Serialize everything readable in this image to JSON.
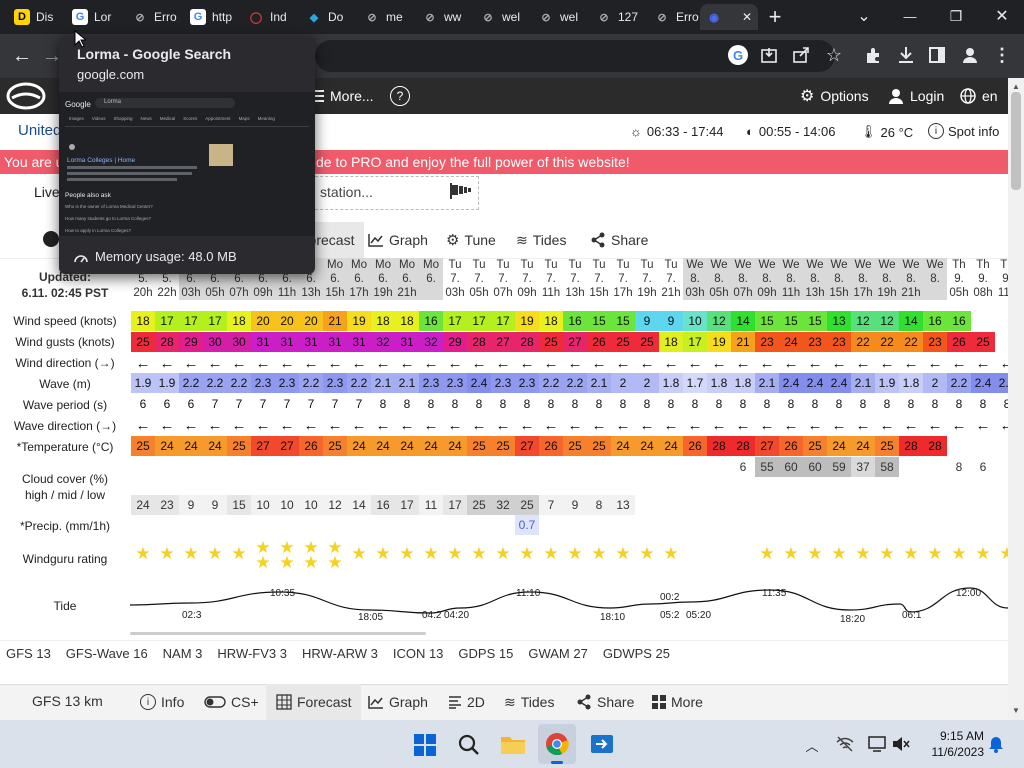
{
  "browser": {
    "tabs": [
      {
        "label": "Dis",
        "fav": "D",
        "favbg": "#ffd400",
        "favfg": "#000"
      },
      {
        "label": "Lor",
        "fav": "G",
        "favbg": "#fff",
        "favfg": "#4285f4"
      },
      {
        "label": "Erro",
        "fav": "⊘",
        "favbg": "#202124",
        "favfg": "#aaa"
      },
      {
        "label": "http",
        "fav": "G",
        "favbg": "#fff",
        "favfg": "#4285f4"
      },
      {
        "label": "Ind",
        "fav": "◯",
        "favbg": "#202124",
        "favfg": "#e53935"
      },
      {
        "label": "Do",
        "fav": "◆",
        "favbg": "#202124",
        "favfg": "#2aa6e0"
      },
      {
        "label": "me",
        "fav": "⊘",
        "favbg": "#202124",
        "favfg": "#aaa"
      },
      {
        "label": "ww",
        "fav": "⊘",
        "favbg": "#202124",
        "favfg": "#aaa"
      },
      {
        "label": "wel",
        "fav": "⊘",
        "favbg": "#202124",
        "favfg": "#aaa"
      },
      {
        "label": "wel",
        "fav": "⊘",
        "favbg": "#202124",
        "favfg": "#aaa"
      },
      {
        "label": "127",
        "fav": "⊘",
        "favbg": "#202124",
        "favfg": "#aaa"
      },
      {
        "label": "Erro",
        "fav": "⊘",
        "favbg": "#202124",
        "favfg": "#aaa"
      },
      {
        "label": "",
        "fav": "◉",
        "favbg": "#35363a",
        "favfg": "#4a6cf7"
      }
    ],
    "new_tab": "+",
    "close_tab": "✕",
    "window_controls": {
      "minimize": "—",
      "restore": "❐",
      "close": "✕",
      "dropdown": "⌄"
    },
    "nav": {
      "back": "←",
      "forward": "→"
    }
  },
  "tooltip": {
    "title": "Lorma - Google Search",
    "domain": "google.com",
    "memory": "Memory usage: 48.0 MB",
    "preview": {
      "logo": "Google",
      "query": "Lorma",
      "nav": [
        "Images",
        "Videos",
        "Shopping",
        "News",
        "Medical",
        "Scores",
        "Appointment",
        "Maps",
        "Meaning"
      ],
      "result_title": "Lorma Colleges | Home",
      "paa_title": "People also ask",
      "paa": [
        "Who is the owner of Lorma Medical Center?",
        "How many students go to Lorma Colleges?",
        "How to apply in Lorma Colleges?"
      ]
    }
  },
  "site": {
    "header": {
      "more": "More...",
      "help": "?",
      "options": "Options",
      "login": "Login",
      "lang": "en"
    },
    "spot": {
      "name": "United",
      "sun": "06:33 - 17:44",
      "moon": "00:55 - 14:06",
      "temp": "26 °C",
      "spotinfo": "Spot info"
    },
    "promo": {
      "left": "You are u",
      "right": "de to PRO and enjoy the full power of this website!"
    },
    "live": {
      "label": "Live",
      "station": "station..."
    },
    "model_tabs": [
      "Forecast",
      "Graph",
      "Tune",
      "Tides",
      "Share"
    ],
    "updated": {
      "label": "Updated:",
      "value": "6.11. 02:45 PST"
    },
    "row_labels": {
      "wind": "Wind speed (knots)",
      "gust": "Wind gusts (knots)",
      "wdir": "Wind direction (→)",
      "wave": "Wave (m)",
      "period": "Wave period (s)",
      "wavedir": "Wave direction (→)",
      "temp": "*Temperature (°C)",
      "cloud1": "Cloud cover (%)",
      "cloud2": "high / mid / low",
      "precip": "*Precip. (mm/1h)",
      "rating": "Windguru rating",
      "tide": "Tide"
    },
    "model_links": [
      "GFS 13",
      "GFS-Wave 16",
      "NAM 3",
      "HRW-FV3 3",
      "HRW-ARW 3",
      "ICON 13",
      "GDPS 15",
      "GWAM 27",
      "GDWPS 25"
    ],
    "bottom": {
      "model": "GFS 13 km",
      "items": [
        "Info",
        "CS+",
        "Forecast",
        "Graph",
        "2D",
        "Tides",
        "Share",
        "More"
      ]
    }
  },
  "forecast": {
    "days": [
      "5.",
      "5.",
      "6.",
      "6.",
      "6.",
      "6.",
      "6.",
      "6.",
      "6.",
      "6.",
      "6.",
      "6.",
      "6.",
      "7.",
      "7.",
      "7.",
      "7.",
      "7.",
      "7.",
      "7.",
      "7.",
      "7.",
      "7.",
      "8.",
      "8.",
      "8.",
      "8.",
      "8.",
      "8.",
      "8.",
      "8.",
      "8.",
      "8.",
      "8.",
      "9.",
      "9.",
      "9.",
      "9."
    ],
    "weekdays": [
      "",
      "",
      "",
      "",
      "",
      "",
      "",
      "",
      "Mo",
      "Mo",
      "Mo",
      "Mo",
      "Mo",
      "Tu",
      "Tu",
      "Tu",
      "Tu",
      "Tu",
      "Tu",
      "Tu",
      "Tu",
      "Tu",
      "Tu",
      "We",
      "We",
      "We",
      "We",
      "We",
      "We",
      "We",
      "We",
      "We",
      "We",
      "We",
      "Th",
      "Th",
      "Th",
      "Th"
    ],
    "hours": [
      "20h",
      "22h",
      "03h",
      "05h",
      "07h",
      "09h",
      "11h",
      "13h",
      "15h",
      "17h",
      "19h",
      "21h",
      "",
      "03h",
      "05h",
      "07h",
      "09h",
      "11h",
      "13h",
      "15h",
      "17h",
      "19h",
      "21h",
      "03h",
      "05h",
      "07h",
      "09h",
      "11h",
      "13h",
      "15h",
      "17h",
      "19h",
      "21h",
      "",
      "05h",
      "08h",
      "11h",
      "14h"
    ],
    "gray_cols": [
      2,
      3,
      4,
      5,
      6,
      7,
      8,
      9,
      10,
      11,
      12,
      23,
      24,
      25,
      26,
      27,
      28,
      29,
      30,
      31,
      32,
      33
    ],
    "wind": [
      18,
      17,
      17,
      17,
      18,
      20,
      20,
      20,
      21,
      19,
      18,
      18,
      16,
      17,
      17,
      17,
      19,
      18,
      16,
      15,
      15,
      9,
      9,
      10,
      12,
      14,
      15,
      15,
      15,
      13,
      12,
      12,
      14,
      16,
      16
    ],
    "gust": [
      25,
      28,
      29,
      30,
      30,
      31,
      31,
      31,
      31,
      31,
      32,
      31,
      32,
      29,
      28,
      27,
      28,
      25,
      27,
      26,
      25,
      25,
      18,
      17,
      19,
      21,
      23,
      24,
      23,
      23,
      22,
      22,
      22,
      23,
      26,
      25
    ],
    "wave": [
      1.9,
      1.9,
      2.2,
      2.2,
      2.2,
      2.3,
      2.3,
      2.2,
      2.3,
      2.2,
      2.1,
      2.1,
      2.3,
      2.3,
      2.4,
      2.3,
      2.3,
      2.2,
      2.2,
      2.1,
      2,
      2,
      1.8,
      1.7,
      1.8,
      1.8,
      2.1,
      2.4,
      2.4,
      2.4,
      2.1,
      1.9,
      1.8,
      2,
      2.2,
      2.4,
      2.4
    ],
    "period": [
      6,
      6,
      6,
      7,
      7,
      7,
      7,
      7,
      7,
      7,
      8,
      8,
      8,
      8,
      8,
      8,
      8,
      8,
      8,
      8,
      8,
      8,
      8,
      8,
      8,
      8,
      8,
      8,
      8,
      8,
      8,
      8,
      8,
      8,
      8,
      8,
      8
    ],
    "temp": [
      25,
      24,
      24,
      24,
      25,
      27,
      27,
      26,
      25,
      24,
      24,
      24,
      24,
      24,
      25,
      25,
      27,
      26,
      25,
      25,
      24,
      24,
      24,
      26,
      28,
      28,
      27,
      26,
      25,
      24,
      24,
      25,
      28,
      28
    ],
    "cloud_high": [
      "",
      "",
      "",
      "",
      "",
      "",
      "",
      "",
      "",
      "",
      "",
      "",
      "",
      "",
      "",
      "",
      "",
      "",
      "",
      "",
      "",
      "",
      "",
      "",
      "",
      "6",
      "55",
      "60",
      "60",
      "59",
      "37",
      "58",
      "",
      "",
      "8",
      "6",
      "",
      ""
    ],
    "cloud_low": [
      "24",
      "23",
      "9",
      "9",
      "15",
      "10",
      "10",
      "10",
      "12",
      "14",
      "16",
      "17",
      "11",
      "17",
      "25",
      "32",
      "25",
      "7",
      "9",
      "8",
      "13"
    ],
    "precip": [
      "",
      "",
      "",
      "",
      "",
      "",
      "",
      "",
      "",
      "",
      "",
      "",
      "",
      "",
      "",
      "",
      "0.7"
    ],
    "rating": [
      1,
      1,
      1,
      1,
      1,
      2,
      2,
      2,
      2,
      1,
      1,
      1,
      1,
      1,
      1,
      1,
      1,
      1,
      1,
      1,
      1,
      1,
      1,
      0,
      0,
      0,
      1,
      1,
      1,
      1,
      1,
      1,
      1,
      1,
      1,
      1,
      1,
      1
    ],
    "tide_labels": [
      "10:35",
      "02:3",
      "18:05",
      "04:2",
      "04:20",
      "11:10",
      "18:10",
      "00:2",
      "05:2",
      "05:20",
      "11:35",
      "18:20",
      "06:1",
      "12:00"
    ]
  },
  "taskbar": {
    "time": "9:15 AM",
    "date": "11/6/2023"
  }
}
